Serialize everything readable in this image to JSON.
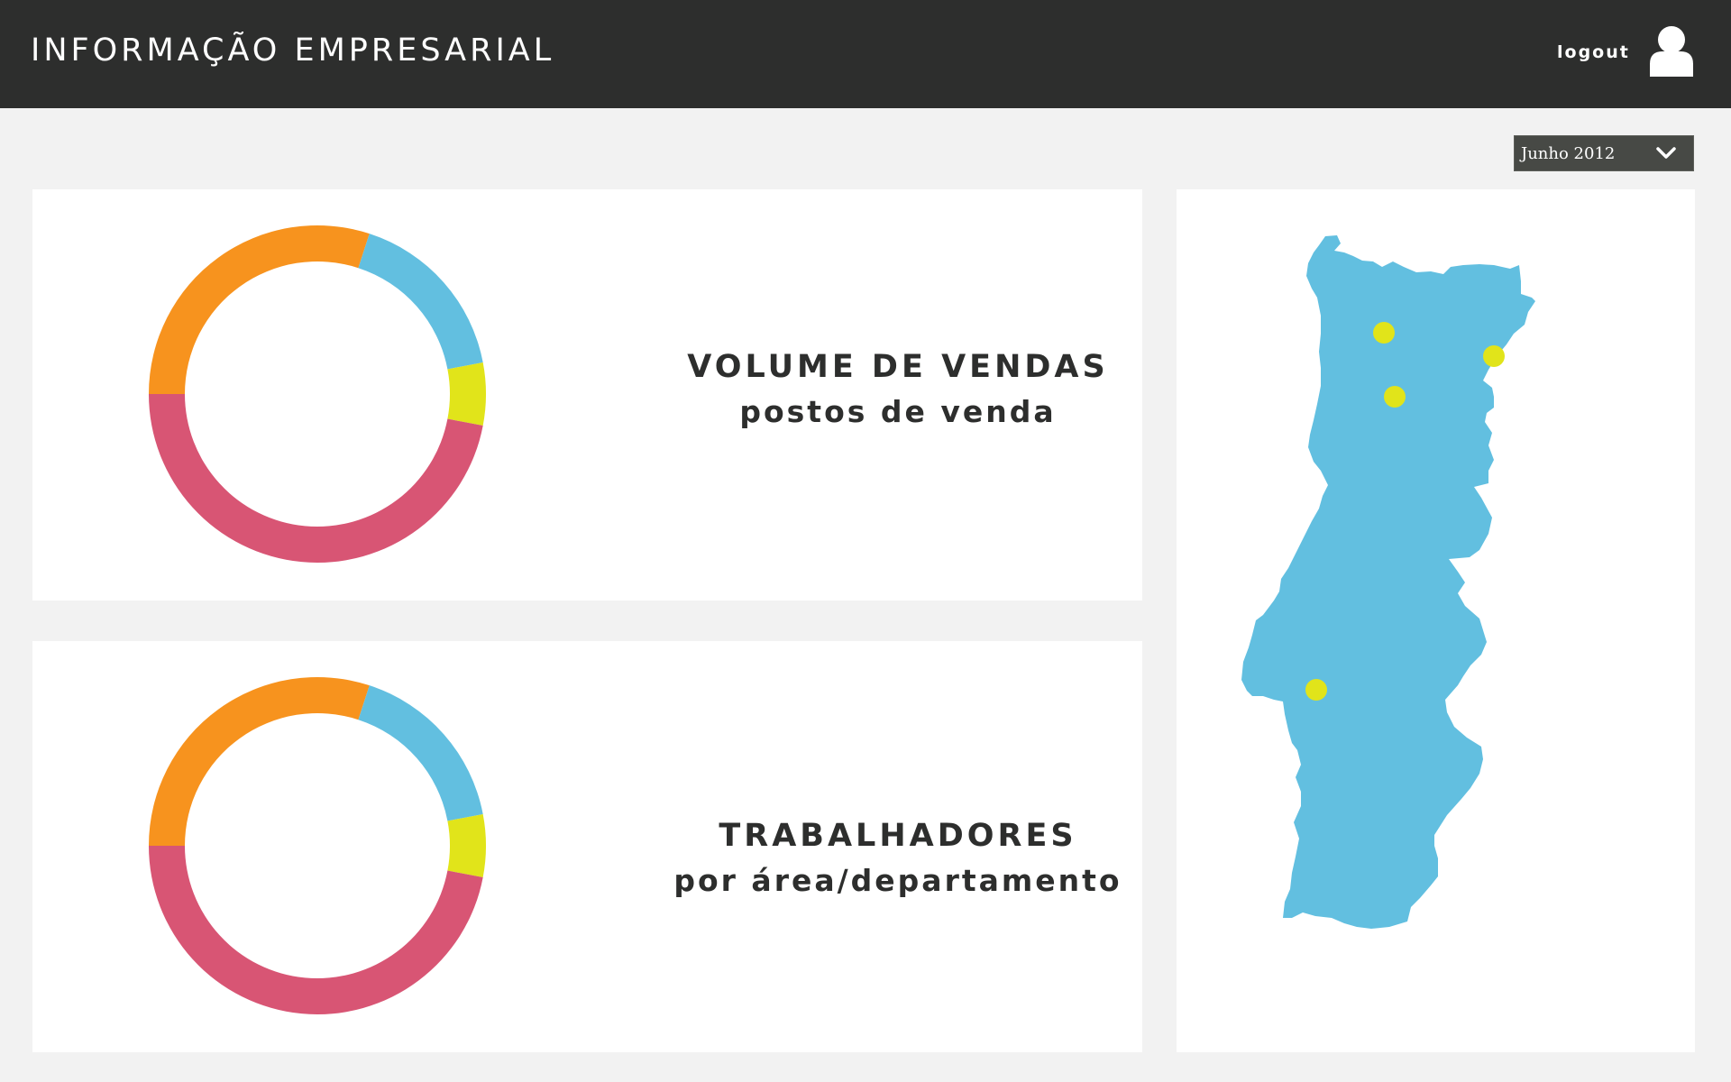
{
  "header": {
    "title": "INFORMAÇÃO EMPRESARIAL",
    "logout_label": "logout",
    "avatar_icon": "user-avatar-icon"
  },
  "period_select": {
    "value": "Junho 2012",
    "icon": "chevron-down-icon"
  },
  "colors": {
    "topbar": "#2d2e2d",
    "background": "#f2f2f2",
    "orange": "#f7931e",
    "blue": "#62bfe0",
    "yellow": "#e1e41a",
    "pink": "#d85574",
    "map_fill": "#62bfe0",
    "marker": "#e1e41a"
  },
  "panels": {
    "sales": {
      "heading": "VOLUME DE VENDAS",
      "subheading": "postos de venda"
    },
    "workers": {
      "heading": "TRABALHADORES",
      "subheading": "por área/departamento"
    }
  },
  "chart_data": [
    {
      "type": "pie",
      "donut": true,
      "title": "",
      "slices": [
        {
          "color": "#f7931e",
          "value": 30
        },
        {
          "color": "#62bfe0",
          "value": 17
        },
        {
          "color": "#e1e41a",
          "value": 6
        },
        {
          "color": "#d85574",
          "value": 47
        }
      ]
    },
    {
      "type": "pie",
      "donut": true,
      "title": "",
      "slices": [
        {
          "color": "#f7931e",
          "value": 30
        },
        {
          "color": "#62bfe0",
          "value": 17
        },
        {
          "color": "#e1e41a",
          "value": 6
        },
        {
          "color": "#d85574",
          "value": 47
        }
      ]
    }
  ],
  "map": {
    "region": "Portugal",
    "markers": 4
  }
}
